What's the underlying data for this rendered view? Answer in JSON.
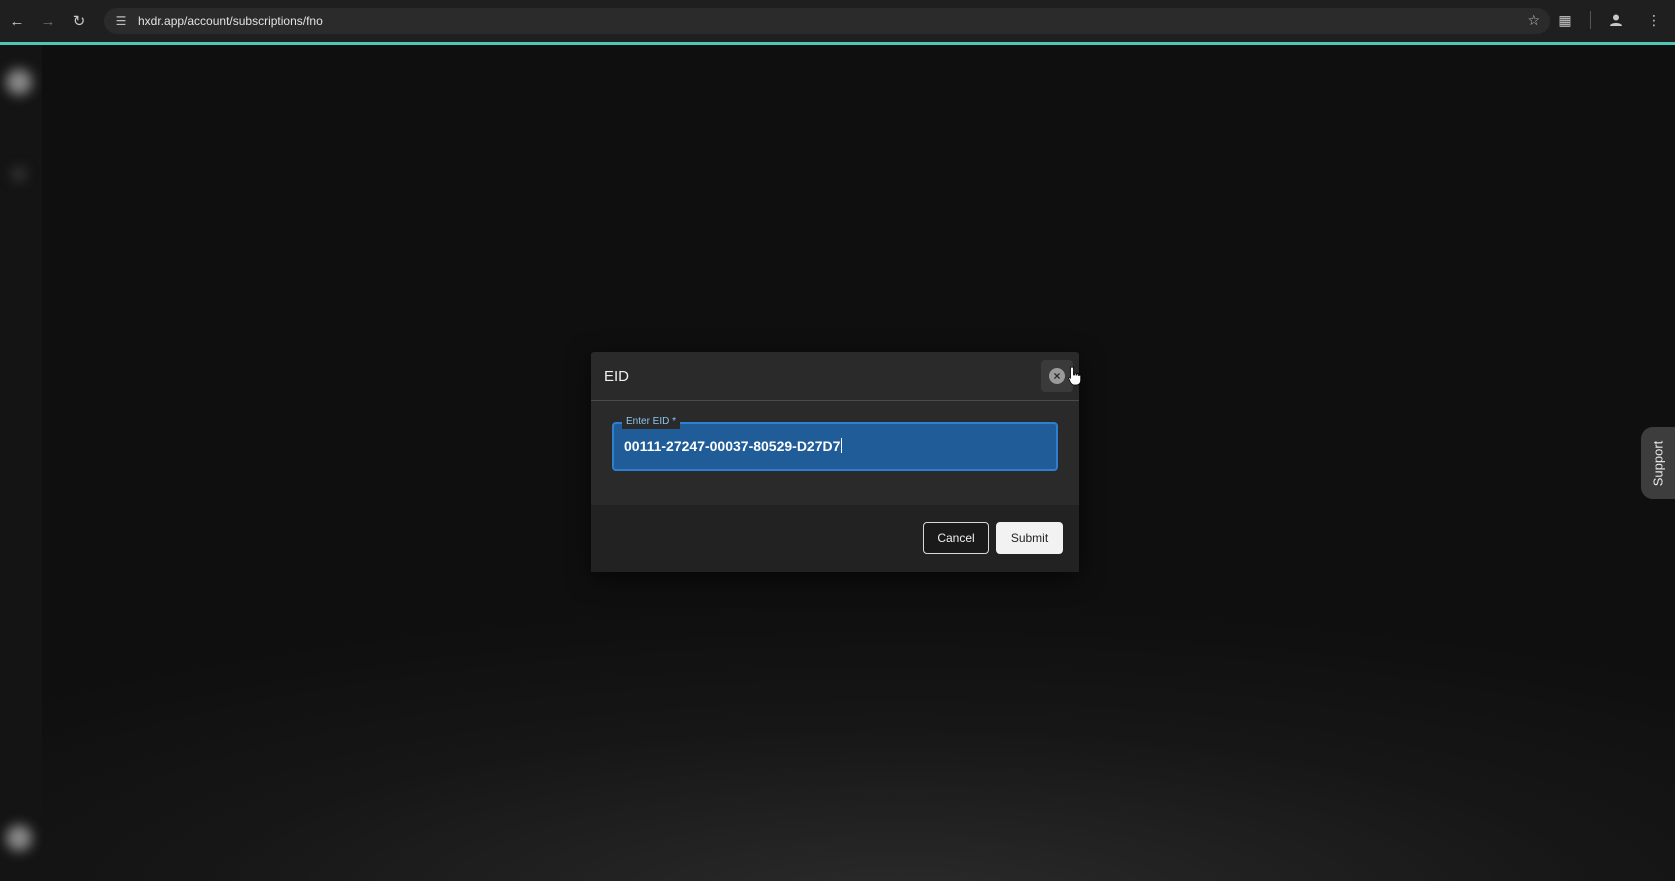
{
  "browser": {
    "url": "hxdr.app/account/subscriptions/fno",
    "accent_color": "#4fc6b6"
  },
  "modal": {
    "title": "EID",
    "field": {
      "label": "Enter EID *",
      "value": "00111-27247-00037-80529-D27D7"
    },
    "cancel_label": "Cancel",
    "submit_label": "Submit"
  },
  "support": {
    "label": "Support"
  },
  "icons": {
    "back": "arrow-left-icon",
    "forward": "arrow-right-icon",
    "reload": "reload-icon",
    "site_info": "tune-icon",
    "bookmark": "star-icon",
    "extensions": "puzzle-icon",
    "profile": "person-icon",
    "menu": "kebab-menu-icon",
    "close": "close-circle-icon"
  },
  "colors": {
    "field_border": "#2e7fd0",
    "field_fill": "#1f5c98"
  }
}
